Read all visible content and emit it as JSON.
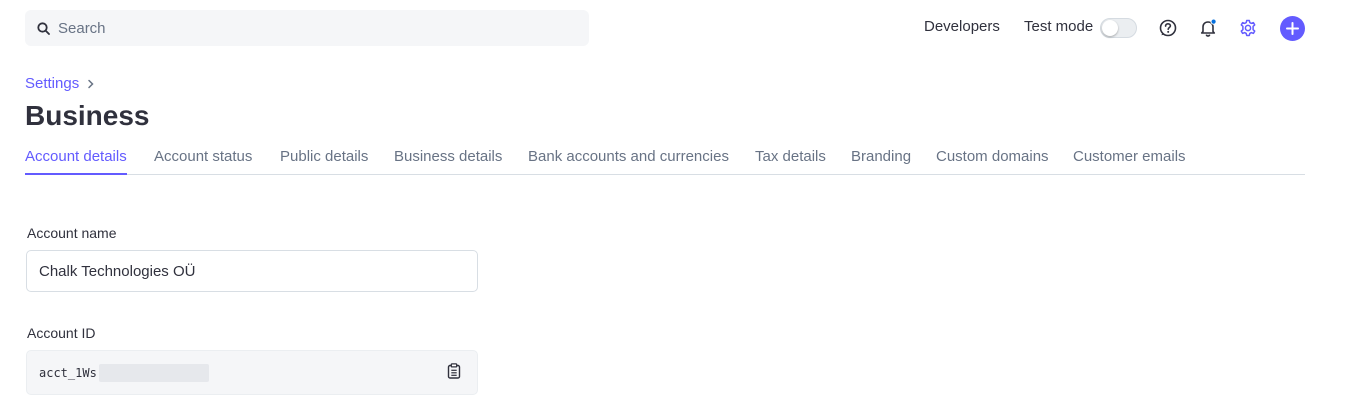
{
  "search": {
    "placeholder": "Search"
  },
  "topnav": {
    "developers": "Developers",
    "test_mode": "Test mode",
    "test_mode_enabled": false
  },
  "icons": {
    "search": "search-icon",
    "help": "help-circle-icon",
    "bell": "bell-icon",
    "gear": "gear-icon",
    "plus": "plus-icon",
    "chevron": "chevron-right-icon",
    "copy": "clipboard-icon"
  },
  "colors": {
    "accent": "#635bff",
    "text": "#30313d",
    "muted": "#687385",
    "notification_dot": "#0570de"
  },
  "breadcrumb": {
    "settings": "Settings"
  },
  "page": {
    "title": "Business"
  },
  "tabs": [
    {
      "label": "Account details",
      "active": true
    },
    {
      "label": "Account status"
    },
    {
      "label": "Public details"
    },
    {
      "label": "Business details"
    },
    {
      "label": "Bank accounts and currencies"
    },
    {
      "label": "Tax details"
    },
    {
      "label": "Branding"
    },
    {
      "label": "Custom domains"
    },
    {
      "label": "Customer emails"
    }
  ],
  "form": {
    "account_name_label": "Account name",
    "account_name_value": "Chalk Technologies OÜ",
    "account_id_label": "Account ID",
    "account_id_value": "acct_1Ws"
  }
}
